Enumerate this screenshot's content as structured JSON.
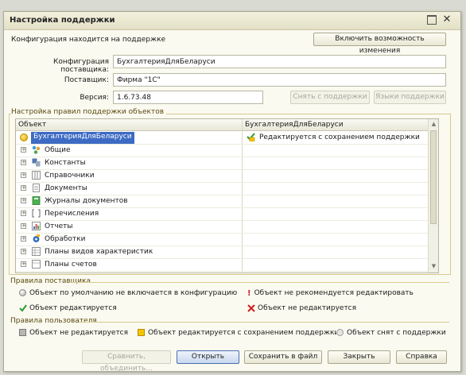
{
  "window": {
    "title": "Настройка поддержки"
  },
  "status_text": "Конфигурация находится на поддержке",
  "enable_changes_button": "Включить возможность изменения",
  "fields": {
    "vendor_config_label": "Конфигурация поставщика:",
    "vendor_config_value": "БухгалтерияДляБеларуси",
    "vendor_label": "Поставщик:",
    "vendor_value": "Фирма \"1С\"",
    "version_label": "Версия:",
    "version_value": "1.6.73.48"
  },
  "remove_support_button": "Снять с поддержки",
  "support_languages_button": "Языки поддержки",
  "rules_group_title": "Настройка правил поддержки объектов",
  "tree": {
    "col_object": "Объект",
    "col_config": "БухгалтерияДляБеларуси",
    "root_label": "БухгалтерияДляБеларуси",
    "root_rule": "Редактируется с сохранением поддержки",
    "items": [
      {
        "label": "Общие",
        "icon": "common-objects-icon"
      },
      {
        "label": "Константы",
        "icon": "constants-icon"
      },
      {
        "label": "Справочники",
        "icon": "catalogs-icon"
      },
      {
        "label": "Документы",
        "icon": "documents-icon"
      },
      {
        "label": "Журналы документов",
        "icon": "document-journals-icon"
      },
      {
        "label": "Перечисления",
        "icon": "enumerations-icon"
      },
      {
        "label": "Отчеты",
        "icon": "reports-icon"
      },
      {
        "label": "Обработки",
        "icon": "data-processors-icon"
      },
      {
        "label": "Планы видов характеристик",
        "icon": "characteristic-types-icon"
      },
      {
        "label": "Планы счетов",
        "icon": "charts-of-accounts-icon"
      }
    ]
  },
  "vendor_rules": {
    "title": "Правила поставщика",
    "not_included": "Объект по умолчанию не включается в конфигурацию",
    "not_recommended": "Объект не рекомендуется редактировать",
    "editable": "Объект редактируется",
    "not_editable": "Объект не редактируется"
  },
  "user_rules": {
    "title": "Правила пользователя",
    "not_editable": "Объект не редактируется",
    "editable_with_support": "Объект редактируется с сохранением поддержки",
    "removed_from_support": "Объект снят с поддержки"
  },
  "footer": {
    "compare_merge": "Сравнить, объединить...",
    "open": "Открыть",
    "save_to_file": "Сохранить в файл",
    "close": "Закрыть",
    "help": "Справка"
  },
  "colors": {
    "accent": "#4a6fb0",
    "group_line": "#d6c98e",
    "selection": "#3d6bc4"
  }
}
